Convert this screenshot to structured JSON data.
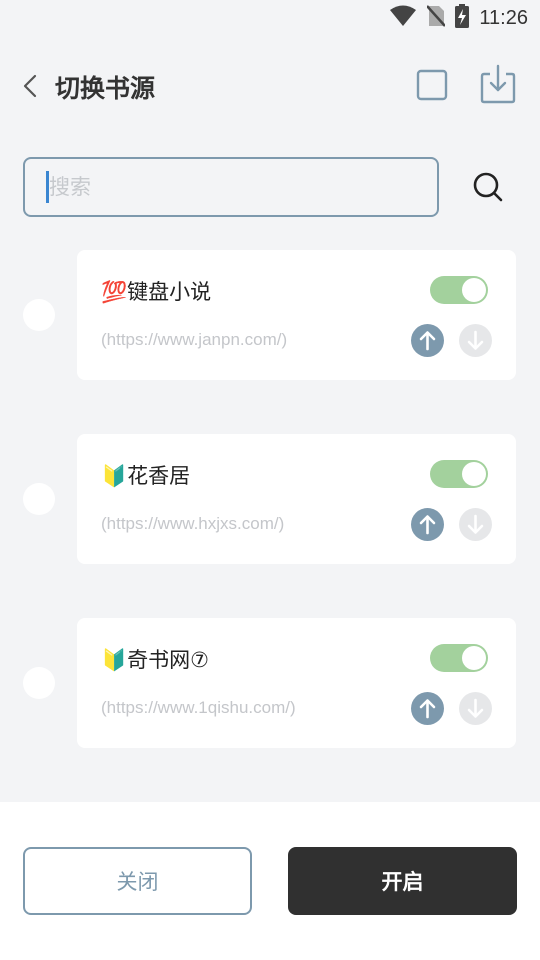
{
  "status_bar": {
    "time": "11:26",
    "icons": [
      "wifi-icon",
      "no-sim-icon",
      "battery-charging-icon"
    ]
  },
  "header": {
    "title": "切换书源",
    "icons": [
      "back-arrow-icon",
      "checkbox-icon",
      "import-download-icon"
    ]
  },
  "search": {
    "placeholder": "搜索",
    "value": "",
    "icon": "search-icon"
  },
  "sources": [
    {
      "name": "💯键盘小说",
      "url": "(https://www.janpn.com/)",
      "enabled": true
    },
    {
      "name": "🔰花香居",
      "url": "(https://www.hxjxs.com/)",
      "enabled": true
    },
    {
      "name": "🔰奇书网⑦",
      "url": "(https://www.1qishu.com/)",
      "enabled": true
    }
  ],
  "footer": {
    "close_label": "关闭",
    "enable_label": "开启"
  },
  "colors": {
    "accent": "#7d99ad",
    "toggle_on": "#a3d19d",
    "dark_button": "#303030",
    "background": "#f3f4f6"
  }
}
